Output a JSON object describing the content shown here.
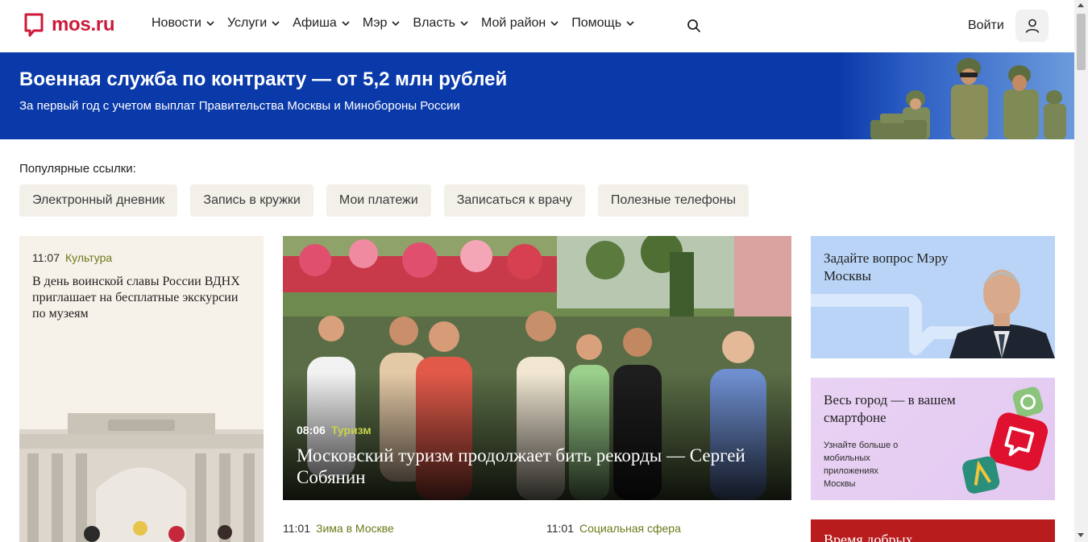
{
  "header": {
    "logo_text": "mos.ru",
    "nav": [
      "Новости",
      "Услуги",
      "Афиша",
      "Мэр",
      "Власть",
      "Мой район",
      "Помощь"
    ],
    "login_label": "Войти"
  },
  "banner": {
    "title": "Военная служба по контракту — от 5,2 млн рублей",
    "subtitle": "За первый год с учетом выплат Правительства Москвы и Минобороны России"
  },
  "popular": {
    "label": "Популярные ссылки:",
    "links": [
      "Электронный дневник",
      "Запись в кружки",
      "Мои платежи",
      "Записаться к врачу",
      "Полезные телефоны"
    ]
  },
  "news_left": {
    "time": "11:07",
    "category": "Культура",
    "title": "В день воинской славы России ВДНХ приглашает на бесплатные экскурсии по музеям"
  },
  "news_main": {
    "time": "08:06",
    "category": "Туризм",
    "title": "Московский туризм продолжает бить рекорды — Сергей Собянин"
  },
  "news_bottom": [
    {
      "time": "11:01",
      "category": "Зима в Москве"
    },
    {
      "time": "11:01",
      "category": "Социальная сфера"
    }
  ],
  "side_cards": {
    "mayor_title": "Задайте вопрос Мэру Москвы",
    "app_title": "Весь город — в вашем смартфоне",
    "app_sub": "Узнайте больше о мобильных приложениях Москвы",
    "red_title": "Время добрых"
  },
  "colors": {
    "brand": "#cc1a3a",
    "banner_bg": "#0a3aa9",
    "category": "#6b7a1a"
  },
  "icons": [
    "chevron-down-icon",
    "search-icon",
    "user-icon",
    "logo-icon"
  ]
}
